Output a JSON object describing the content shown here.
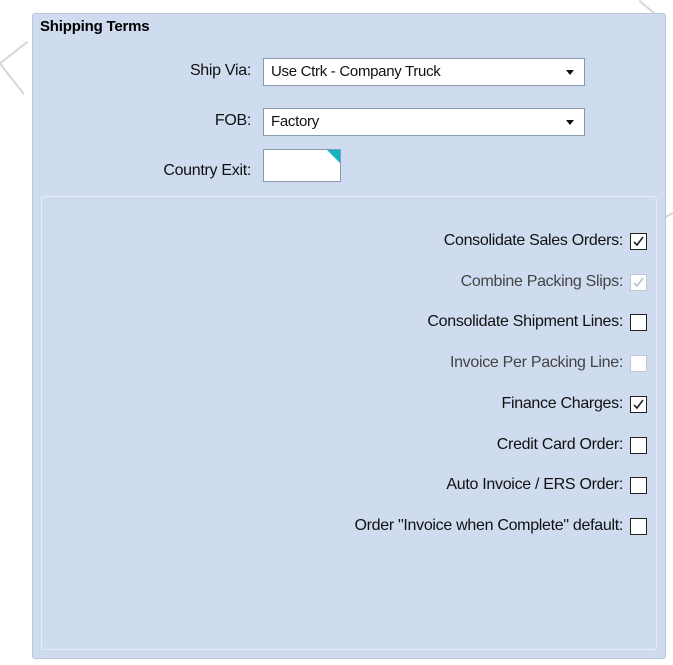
{
  "panel": {
    "title": "Shipping Terms"
  },
  "fields": {
    "ship_via": {
      "label": "Ship Via:",
      "value": "Use Ctrk - Company Truck"
    },
    "fob": {
      "label": "FOB:",
      "value": "Factory"
    },
    "country_exit": {
      "label": "Country Exit:",
      "value": ""
    }
  },
  "options": [
    {
      "label": "Consolidate Sales Orders:",
      "checked": true,
      "enabled": true
    },
    {
      "label": "Combine Packing Slips:",
      "checked": true,
      "enabled": false
    },
    {
      "label": "Consolidate Shipment Lines:",
      "checked": false,
      "enabled": true
    },
    {
      "label": "Invoice Per Packing Line:",
      "checked": false,
      "enabled": false
    },
    {
      "label": "Finance Charges:",
      "checked": true,
      "enabled": true
    },
    {
      "label": "Credit Card Order:",
      "checked": false,
      "enabled": true
    },
    {
      "label": "Auto Invoice / ERS Order:",
      "checked": false,
      "enabled": true
    },
    {
      "label": "Order \"Invoice when Complete\" default:",
      "checked": false,
      "enabled": true
    }
  ],
  "colors": {
    "panel_bg": "#cfdcef",
    "required_flag": "#14b4c0"
  }
}
